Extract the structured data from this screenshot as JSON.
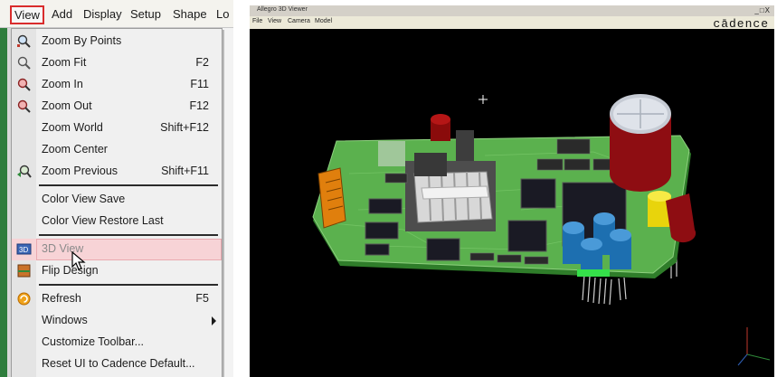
{
  "menubar": {
    "items": [
      "View",
      "Add",
      "Display",
      "Setup",
      "Shape",
      "Lo"
    ]
  },
  "view_menu": {
    "items": [
      {
        "label": "Zoom By Points",
        "shortcut": ""
      },
      {
        "label": "Zoom Fit",
        "shortcut": "F2"
      },
      {
        "label": "Zoom In",
        "shortcut": "F11"
      },
      {
        "label": "Zoom Out",
        "shortcut": "F12"
      },
      {
        "label": "Zoom World",
        "shortcut": "Shift+F12"
      },
      {
        "label": "Zoom Center",
        "shortcut": ""
      },
      {
        "label": "Zoom Previous",
        "shortcut": "Shift+F11"
      },
      {
        "label": "Color View Save",
        "shortcut": ""
      },
      {
        "label": "Color View Restore Last",
        "shortcut": ""
      },
      {
        "label": "3D View",
        "shortcut": ""
      },
      {
        "label": "Flip Design",
        "shortcut": ""
      },
      {
        "label": "Refresh",
        "shortcut": "F5"
      },
      {
        "label": "Windows",
        "shortcut": ""
      },
      {
        "label": "Customize Toolbar...",
        "shortcut": ""
      },
      {
        "label": "Reset UI to Cadence Default...",
        "shortcut": ""
      }
    ],
    "highlighted": "3D View"
  },
  "viewer": {
    "title": "Allegro 3D Viewer",
    "window_buttons": "_□X",
    "menu": [
      "File",
      "View",
      "Camera",
      "Model"
    ],
    "logo": "cādence"
  },
  "icons": {
    "zoom_by_points": "zoom-points-icon",
    "zoom_fit": "zoom-fit-icon",
    "zoom_in": "zoom-in-icon",
    "zoom_out": "zoom-out-icon",
    "zoom_previous": "zoom-previous-icon",
    "view_3d": "3d-view-icon",
    "flip_design": "flip-design-icon",
    "refresh": "refresh-icon"
  },
  "colors": {
    "highlight": "#f7d3d6",
    "active_menu_border": "#d92c2c",
    "pcb": "#4fa84a",
    "viewer_background": "#000000"
  }
}
